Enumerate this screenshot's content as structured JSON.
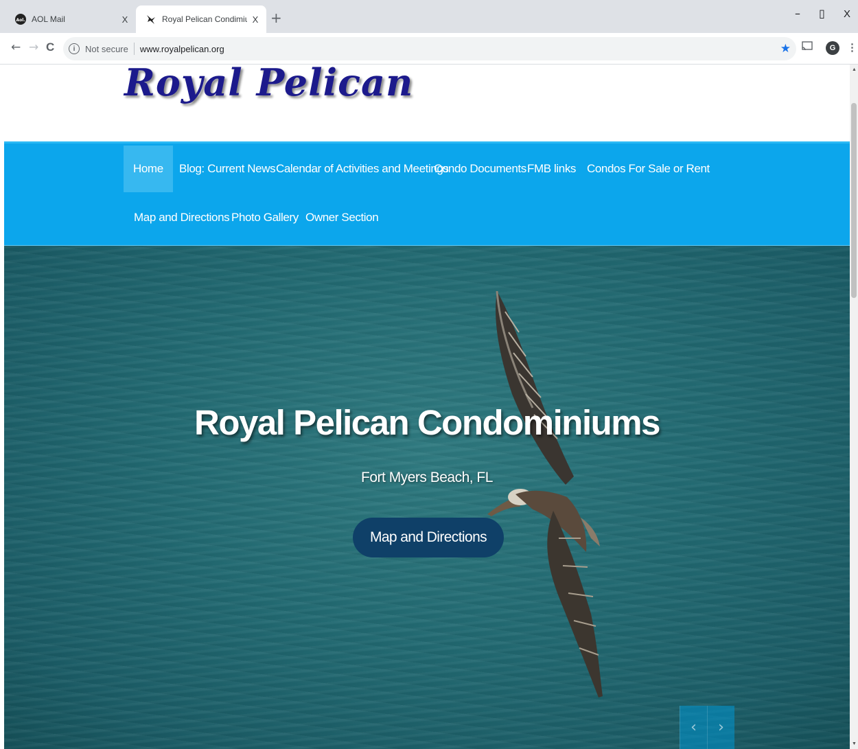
{
  "browser": {
    "tabs": [
      {
        "title": "AOL Mail",
        "icon": "aol-favicon",
        "active": false
      },
      {
        "title": "Royal Pelican Condimiums",
        "icon": "pelican-favicon",
        "active": true
      }
    ],
    "tab_close_label": "X",
    "new_tab_label": "+",
    "window_controls": {
      "minimize": "–",
      "maximize": "▯",
      "close": "X"
    },
    "security_label": "Not secure",
    "url": "www.royalpelican.org",
    "profile_initial": "G"
  },
  "site": {
    "logo_text": "Royal Pelican",
    "nav_items": [
      "Home",
      "Blog: Current News",
      "Calendar of Activities and Meetings",
      "Condo Documents",
      "FMB links",
      "Condos For Sale or Rent",
      "Map and Directions",
      "Photo Gallery",
      "Owner Section"
    ],
    "active_nav": "Home",
    "hero": {
      "title": "Royal Pelican Condominiums",
      "subtitle": "Fort Myers Beach, FL",
      "button_label": "Map and Directions",
      "prev_label": "‹",
      "next_label": "›"
    }
  },
  "colors": {
    "nav_background": "#0ca6ec",
    "nav_active": "#37b8f0",
    "logo": "#1c1a8c",
    "hero_button": "#0f4068",
    "sea": "#226a72"
  }
}
